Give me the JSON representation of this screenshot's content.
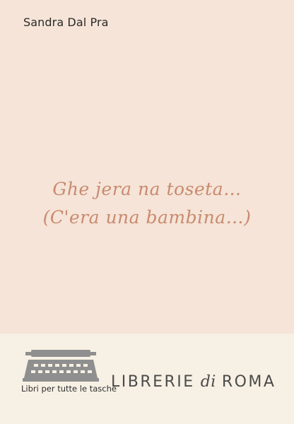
{
  "cover": {
    "author": "Sandra Dal Pra",
    "title_lines": [
      "Ghe jera na toseta…",
      "(C'era una bambina…)"
    ]
  },
  "footer": {
    "series": "Libri per tutte le tasche",
    "brand_left": "LIBRERIE",
    "brand_mid": "di",
    "brand_right": "ROMA",
    "logo_icon": "typewriter-icon"
  },
  "colors": {
    "background": "#f5e4d7",
    "footer_bg": "#f7f0e4",
    "title": "#c98a70",
    "logo": "#8f8f8f"
  }
}
